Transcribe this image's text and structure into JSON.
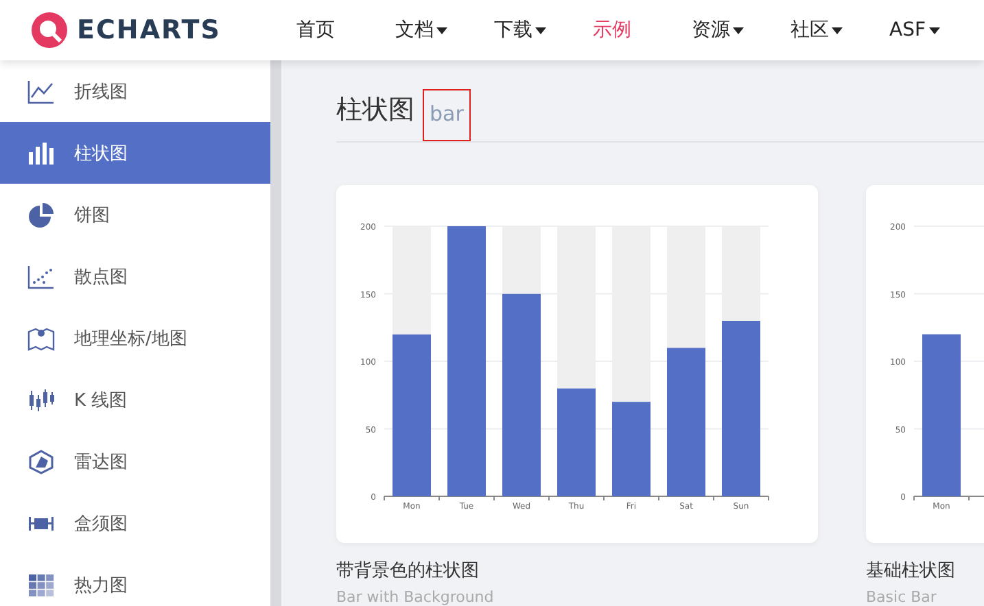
{
  "header": {
    "logo_text": "ECHARTS",
    "nav": [
      {
        "label": "首页",
        "selected": false,
        "has_menu": false
      },
      {
        "label": "文档",
        "selected": false,
        "has_menu": true
      },
      {
        "label": "下载",
        "selected": false,
        "has_menu": true
      },
      {
        "label": "示例",
        "selected": true,
        "has_menu": false
      },
      {
        "label": "资源",
        "selected": false,
        "has_menu": true
      },
      {
        "label": "社区",
        "selected": false,
        "has_menu": true
      },
      {
        "label": "ASF",
        "selected": false,
        "has_menu": true
      }
    ]
  },
  "sidebar": {
    "items": [
      {
        "label": "折线图",
        "selected": false
      },
      {
        "label": "柱状图",
        "selected": true
      },
      {
        "label": "饼图",
        "selected": false
      },
      {
        "label": "散点图",
        "selected": false
      },
      {
        "label": "地理坐标/地图",
        "selected": false
      },
      {
        "label": "K 线图",
        "selected": false
      },
      {
        "label": "雷达图",
        "selected": false
      },
      {
        "label": "盒须图",
        "selected": false
      },
      {
        "label": "热力图",
        "selected": false
      }
    ]
  },
  "section": {
    "title": "柱状图",
    "subtitle": "bar",
    "subtitle_highlighted": true
  },
  "examples": [
    {
      "title": "带背景色的柱状图",
      "subtitle": "Bar with Background",
      "chart_data": {
        "type": "bar",
        "categories": [
          "Mon",
          "Tue",
          "Wed",
          "Thu",
          "Fri",
          "Sat",
          "Sun"
        ],
        "series": [
          {
            "color": "#5470c6",
            "values": [
              120,
              200,
              150,
              80,
              70,
              110,
              130
            ]
          },
          {
            "color": "#efefef",
            "values": [
              80,
              0,
              50,
              120,
              130,
              90,
              70
            ]
          }
        ],
        "stacked": true,
        "ylim": [
          0,
          200
        ],
        "yticks": [
          0,
          50,
          100,
          150,
          200
        ],
        "grid": true
      }
    },
    {
      "title": "基础柱状图",
      "subtitle": "Basic Bar",
      "chart_data": {
        "type": "bar",
        "categories": [
          "Mon"
        ],
        "values": [
          120
        ],
        "ylim": [
          0,
          200
        ],
        "yticks": [
          0,
          50,
          100,
          150,
          200
        ],
        "grid": true
      }
    }
  ]
}
